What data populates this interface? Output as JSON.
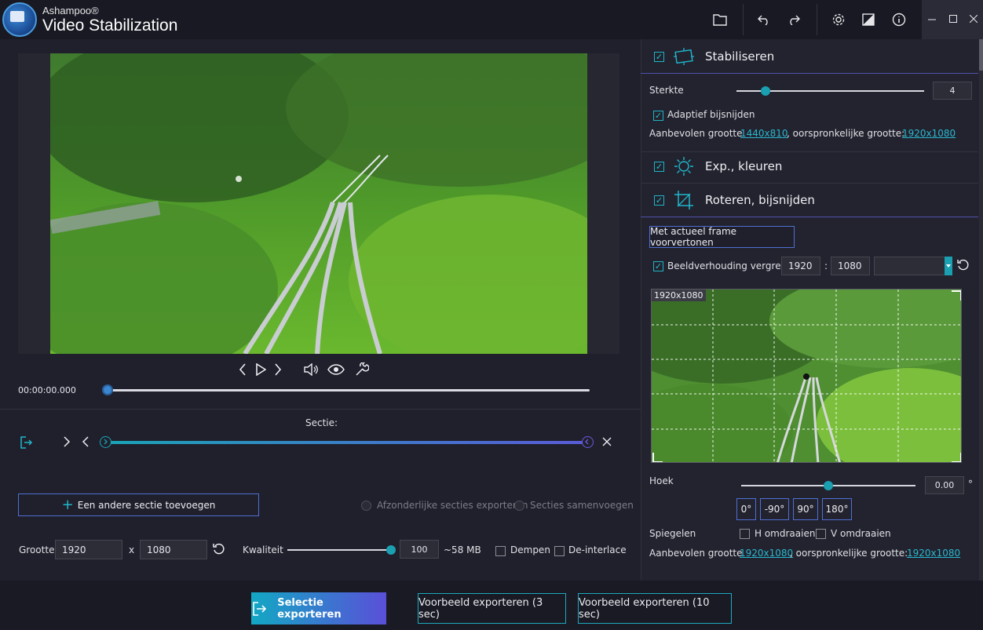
{
  "app": {
    "brand": "Ashampoo®",
    "title": "Video Stabilization"
  },
  "player": {
    "timecode": "00:00:00.000",
    "progress": 0
  },
  "section": {
    "label": "Sectie:",
    "add_button": "Een andere sectie toevoegen",
    "export_separate": "Afzonderlijke secties exporteren",
    "merge": "Secties samenvoegen"
  },
  "output": {
    "size_label": "Grootte",
    "width": "1920",
    "x_label": "x",
    "height": "1080",
    "quality_label": "Kwaliteit",
    "quality_value": "100",
    "quality_level": 1.0,
    "size_estimate": "~58 MB",
    "mute_label": "Dempen",
    "deinterlace_label": "De-interlace"
  },
  "stabilize": {
    "title": "Stabiliseren",
    "strength_label": "Sterkte",
    "strength_value": "4",
    "adaptive_label": "Adaptief bijsnijden",
    "recommended_label": "Aanbevolen grootte",
    "recommended_value": "1440x810",
    "original_label": ", oorspronkelijke grootte:",
    "original_value": "1920x1080"
  },
  "exposure": {
    "title": "Exp., kleuren"
  },
  "rotate": {
    "title": "Roteren, bijsnijden",
    "preview_button": "Met actueel frame voorvertonen",
    "aspect_label": "Beeldverhouding vergre...",
    "aspect_w": "1920",
    "aspect_sep": ":",
    "aspect_h": "1080",
    "crop_badge": "1920x1080",
    "angle_label": "Hoek",
    "angle_value": "0.00",
    "angle_unit": "°",
    "angle_buttons": [
      "0°",
      "-90°",
      "90°",
      "180°"
    ],
    "mirror_label": "Spiegelen",
    "h_flip": "H omdraaien",
    "v_flip": "V omdraaien",
    "recommended_label": "Aanbevolen grootte",
    "recommended_value": "1920x1080",
    "original_label": ", oorspronkelijke grootte:",
    "original_value": "1920x1080"
  },
  "footer": {
    "export_button": "Selectie exporteren",
    "preview3": "Voorbeeld exporteren (3 sec)",
    "preview10": "Voorbeeld exporteren (10 sec)"
  },
  "colors": {
    "accent": "#1fb3c7",
    "accent2": "#5a4fd8",
    "bg": "#1f202b"
  }
}
